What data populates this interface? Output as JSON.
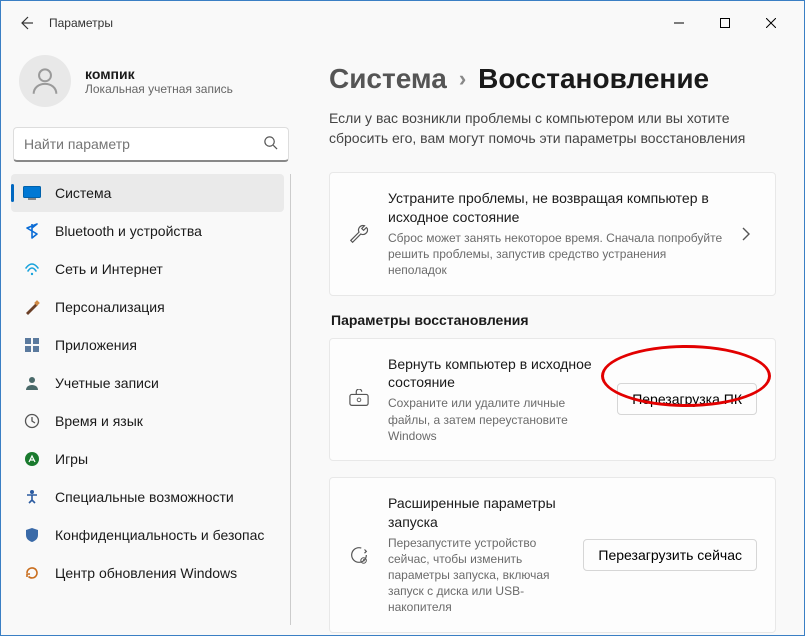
{
  "window": {
    "title": "Параметры"
  },
  "profile": {
    "name": "компик",
    "sub": "Локальная учетная запись"
  },
  "search": {
    "placeholder": "Найти параметр"
  },
  "nav": {
    "items": [
      {
        "label": "Система",
        "icon": "system"
      },
      {
        "label": "Bluetooth и устройства",
        "icon": "bluetooth"
      },
      {
        "label": "Сеть и Интернет",
        "icon": "network"
      },
      {
        "label": "Персонализация",
        "icon": "personalization"
      },
      {
        "label": "Приложения",
        "icon": "apps"
      },
      {
        "label": "Учетные записи",
        "icon": "accounts"
      },
      {
        "label": "Время и язык",
        "icon": "time"
      },
      {
        "label": "Игры",
        "icon": "gaming"
      },
      {
        "label": "Специальные возможности",
        "icon": "accessibility"
      },
      {
        "label": "Конфиденциальность и безопасность",
        "icon": "privacy"
      },
      {
        "label": "Центр обновления Windows",
        "icon": "update"
      }
    ]
  },
  "breadcrumb": {
    "parent": "Система",
    "current": "Восстановление"
  },
  "subtitle": "Если у вас возникли проблемы с компьютером или вы хотите сбросить его, вам могут помочь эти параметры восстановления",
  "troubleshoot": {
    "title": "Устраните проблемы, не возвращая компьютер в исходное состояние",
    "desc": "Сброс может занять некоторое время. Сначала попробуйте решить проблемы, запустив средство устранения неполадок"
  },
  "section": "Параметры восстановления",
  "reset": {
    "title": "Вернуть компьютер в исходное состояние",
    "desc": "Сохраните или удалите личные файлы, а затем переустановите Windows",
    "button": "Перезагрузка ПК"
  },
  "advanced": {
    "title": "Расширенные параметры запуска",
    "desc": "Перезапустите устройство сейчас, чтобы изменить параметры запуска, включая запуск с диска или USB-накопителя",
    "button": "Перезагрузить сейчас"
  }
}
